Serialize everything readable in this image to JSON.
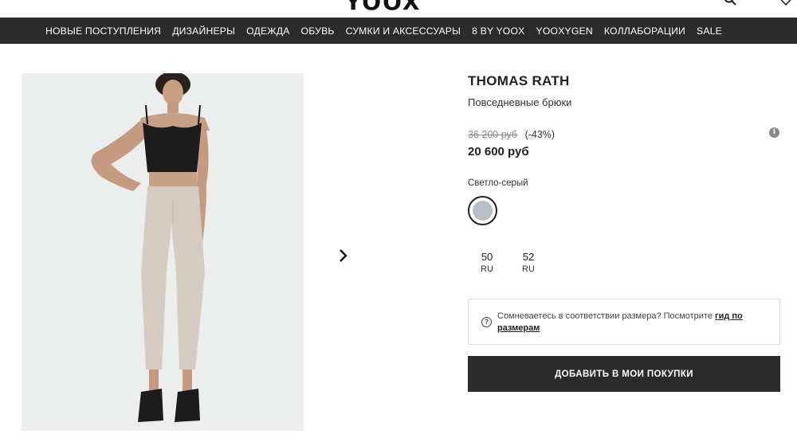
{
  "header": {
    "logo": "YOOX",
    "top_left_text": "· · · · ·"
  },
  "nav": {
    "items": [
      {
        "label": "НОВЫЕ ПОСТУПЛЕНИЯ"
      },
      {
        "label": "ДИЗАЙНЕРЫ"
      },
      {
        "label": "ОДЕЖДА"
      },
      {
        "label": "ОБУВЬ"
      },
      {
        "label": "СУМКИ И АКСЕССУАРЫ"
      },
      {
        "label": "8 BY YOOX"
      },
      {
        "label": "YOOXYGEN"
      },
      {
        "label": "КОЛЛАБОРАЦИИ"
      },
      {
        "label": "SALE"
      }
    ]
  },
  "product": {
    "brand": "THOMAS RATH",
    "category": "Повседневные брюки",
    "old_price": "36 200 руб",
    "discount": "(-43%)",
    "price": "20 600 руб",
    "color_name": "Светло-серый",
    "color_swatch": "#b8bec7",
    "sizes": [
      {
        "size": "50",
        "unit": "RU"
      },
      {
        "size": "52",
        "unit": "RU"
      }
    ],
    "size_guide_text": "Сомневаетесь в соответствии размера? Посмотрите ",
    "size_guide_link": "гид по размерам",
    "add_button": "ДОБАВИТЬ В МОИ ПОКУПКИ"
  },
  "colors": {
    "nav_bg": "#2b2b2b",
    "button_bg": "#2b2b2b",
    "image_bg": "#eceded"
  }
}
